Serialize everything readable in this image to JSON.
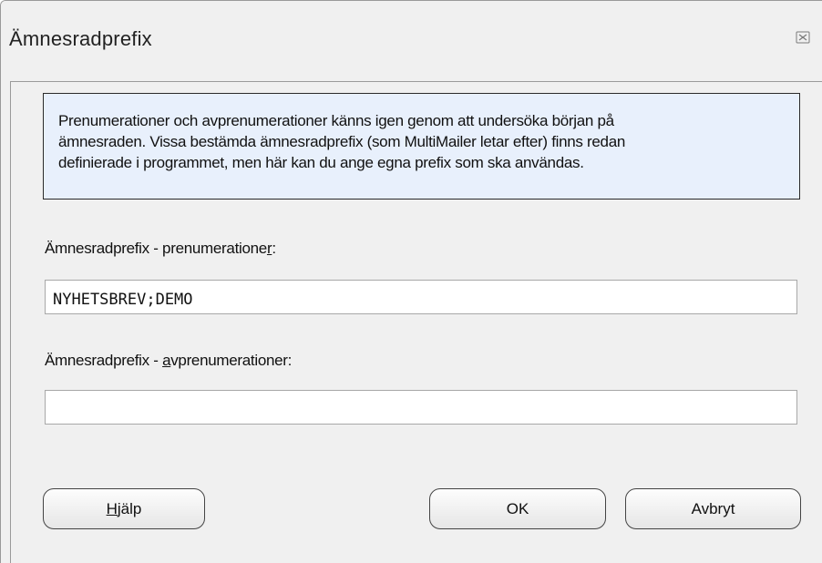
{
  "window": {
    "title": "Ämnesradprefix",
    "close_icon": "close-icon"
  },
  "info": {
    "line1": "Prenumerationer och avprenumerationer känns igen genom att undersöka början på",
    "line2": "ämnesraden. Vissa bestämda ämnesradprefix (som MultiMailer letar efter) finns redan",
    "line3": "definierade i programmet, men här kan du ange egna prefix som ska användas."
  },
  "subscribe": {
    "label_before": "Ämnesradprefix - prenumeratione",
    "label_mnemonic": "r",
    "label_after": ":",
    "value": "NYHETSBREV;DEMO"
  },
  "unsubscribe": {
    "label_before": "Ämnesradprefix - ",
    "label_mnemonic": "a",
    "label_after": "vprenumerationer:",
    "value": ""
  },
  "buttons": {
    "help_mnemonic": "H",
    "help_rest": "jälp",
    "ok": "OK",
    "cancel": "Avbryt"
  }
}
